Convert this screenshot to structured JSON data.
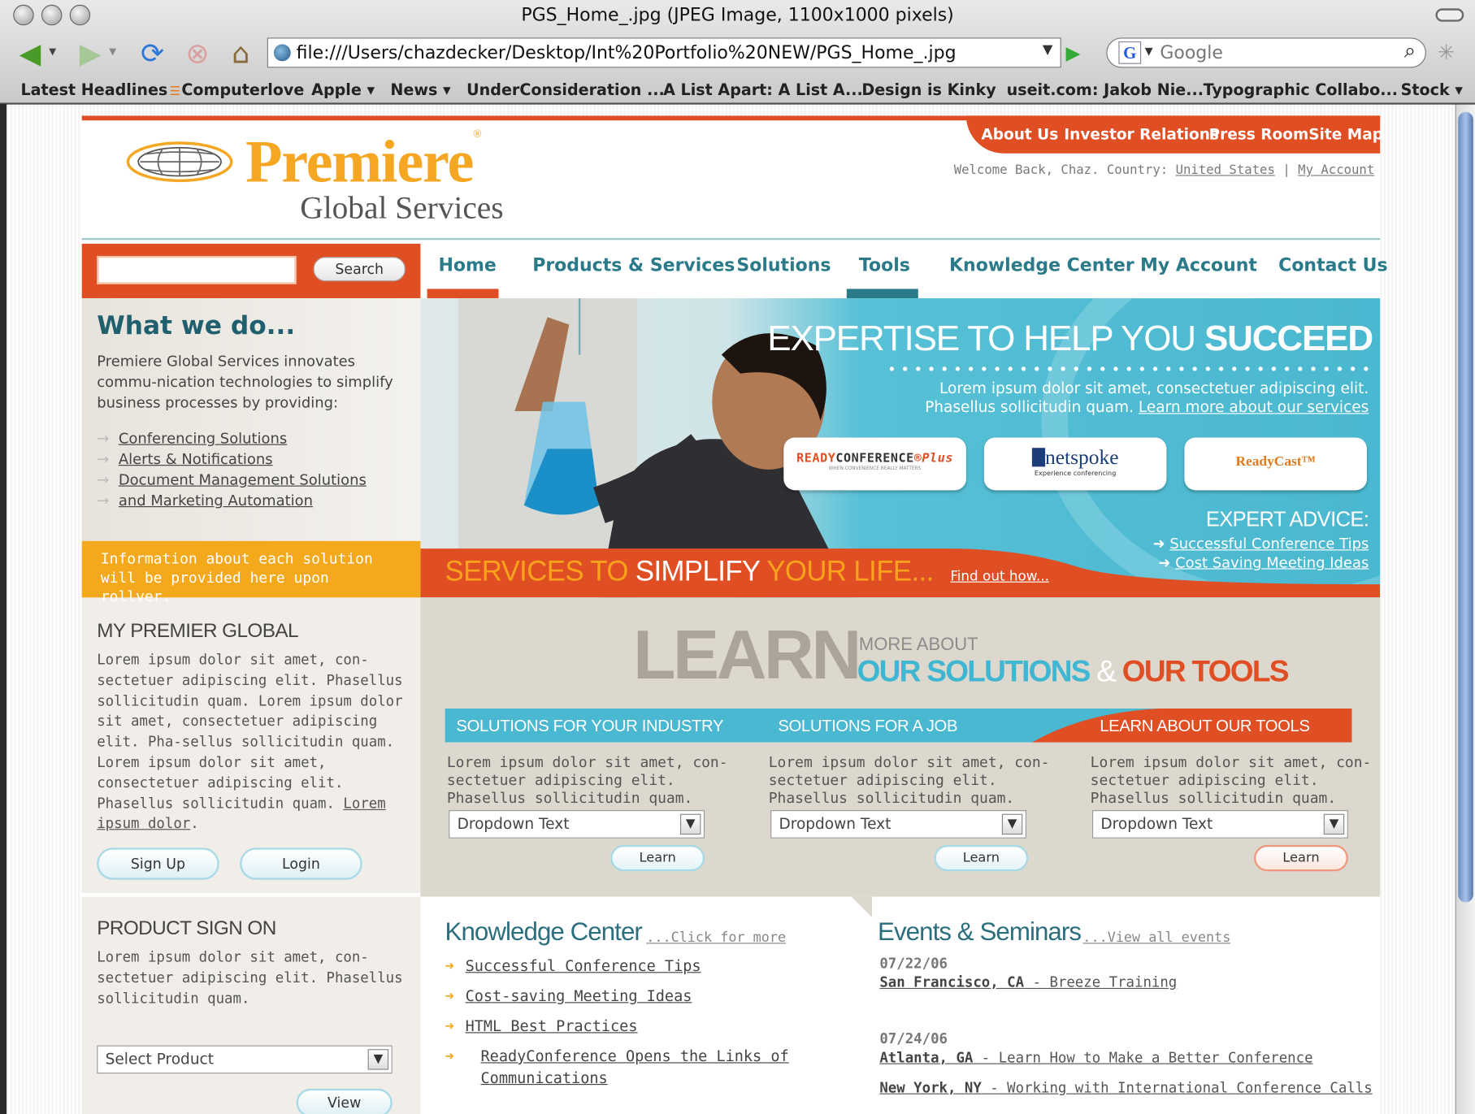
{
  "browser": {
    "window_title": "PGS_Home_.jpg (JPEG Image, 1100x1000 pixels)",
    "url": "file:///Users/chazdecker/Desktop/Int%20Portfolio%20NEW/PGS_Home_.jpg",
    "search_placeholder": "Google",
    "bookmarks": [
      "Latest Headlines",
      "Computerlove",
      "Apple ▾",
      "News ▾",
      "UnderConsideration ...",
      "A List Apart: A List A...",
      "Design is Kinky",
      "useit.com: Jakob Nie...",
      "Typographic Collabo...",
      "Stock ▾"
    ]
  },
  "header": {
    "utility_links": [
      "About Us",
      "Investor Relations",
      "Press Room",
      "Site Map"
    ],
    "welcome_prefix": "Welcome Back, Chaz. Country:",
    "country": "United States",
    "separator": "|",
    "my_account": "My Account",
    "logo_top": "Premiere",
    "logo_bottom": "Global Services"
  },
  "search": {
    "button": "Search"
  },
  "nav": [
    "Home",
    "Products & Services",
    "Solutions",
    "Tools",
    "Knowledge Center",
    "My Account",
    "Contact Us"
  ],
  "what_we_do": {
    "title": "What we do...",
    "description": "Premiere Global Services innovates commu-nication technologies to simplify business processes by providing:",
    "items": [
      "Conferencing Solutions",
      "Alerts & Notifications",
      "Document Management Solutions",
      "and Marketing Automation"
    ],
    "info": "Information about each solution will be provided here upon rollver."
  },
  "hero": {
    "headline_plain": "EXPERTISE TO HELP YOU",
    "headline_bold": "SUCCEED",
    "body": "Lorem ipsum dolor sit amet, consectetuer adipiscing elit. Phasellus sollicitudin quam.",
    "body_link": "Learn more about our services",
    "brands": [
      "READYCONFERENCE Plus",
      "netspoke",
      "ReadyCast™"
    ],
    "brand_sub": [
      "WHEN CONVENIENCE REALLY MATTERS",
      "Experience conferencing"
    ],
    "expert_title": "EXPERT ADVICE:",
    "expert_links": [
      "Successful Conference Tips",
      "Cost Saving Meeting Ideas"
    ],
    "tagline_1": "SERVICES TO",
    "tagline_2": "SIMPLIFY",
    "tagline_3": "YOUR LIFE...",
    "tagline_link": "Find out how..."
  },
  "my_premier": {
    "title": "MY PREMIER GLOBAL",
    "text": "Lorem ipsum dolor sit amet, con-sectetuer adipiscing elit. Phasellus sollicitudin quam. Lorem ipsum dolor sit amet, consectetuer adipiscing elit. Pha-sellus sollicitudin quam. Lorem ipsum dolor sit amet, consectetuer adipiscing elit. Phasellus sollicitudin quam.",
    "text_link": "Lorem ipsum dolor",
    "sign_up": "Sign Up",
    "login": "Login"
  },
  "product_sign_on": {
    "title": "PRODUCT SIGN ON",
    "text": "Lorem ipsum dolor sit amet, con-sectetuer adipiscing elit. Phasellus sollicitudin quam.",
    "select": "Select Product",
    "view": "View"
  },
  "learn": {
    "big": "LEARN",
    "more_about": "MORE ABOUT",
    "solutions": "OUR SOLUTIONS",
    "amp": "&",
    "tools": "OUR TOOLS",
    "columns": [
      {
        "heading": "SOLUTIONS FOR YOUR INDUSTRY",
        "text": "Lorem ipsum dolor sit amet, con-sectetuer adipiscing elit. Phasellus sollicitudin quam.",
        "dropdown": "Dropdown Text",
        "button": "Learn"
      },
      {
        "heading": "SOLUTIONS FOR A JOB",
        "text": "Lorem ipsum dolor sit amet, con-sectetuer adipiscing elit. Phasellus sollicitudin quam.",
        "dropdown": "Dropdown Text",
        "button": "Learn"
      },
      {
        "heading": "LEARN ABOUT OUR TOOLS",
        "text": "Lorem ipsum dolor sit amet, con-sectetuer adipiscing elit. Phasellus sollicitudin quam.",
        "dropdown": "Dropdown Text",
        "button": "Learn"
      }
    ]
  },
  "knowledge_center": {
    "title": "Knowledge Center",
    "more": "...Click for more",
    "items": [
      "Successful Conference Tips",
      "Cost-saving Meeting Ideas",
      "HTML Best Practices",
      "ReadyConference Opens the Links of Communications"
    ]
  },
  "events": {
    "title": "Events & Seminars",
    "more": "...View all events",
    "groups": [
      {
        "date": "07/22/06",
        "entries": [
          {
            "city": "San Francisco, CA",
            "name": "Breeze Training"
          }
        ]
      },
      {
        "date": "07/24/06",
        "entries": [
          {
            "city": "Atlanta, GA",
            "name": "Learn How to Make a Better Conference"
          },
          {
            "city": "New York, NY",
            "name": "Working with International Conference Calls"
          }
        ]
      }
    ],
    "dash": " - "
  },
  "colors": {
    "orange_red": "#e04e24",
    "amber": "#f4a81c",
    "teal": "#2b7a8a",
    "cyan": "#4ab8d0",
    "sand": "#ddd8ce"
  }
}
